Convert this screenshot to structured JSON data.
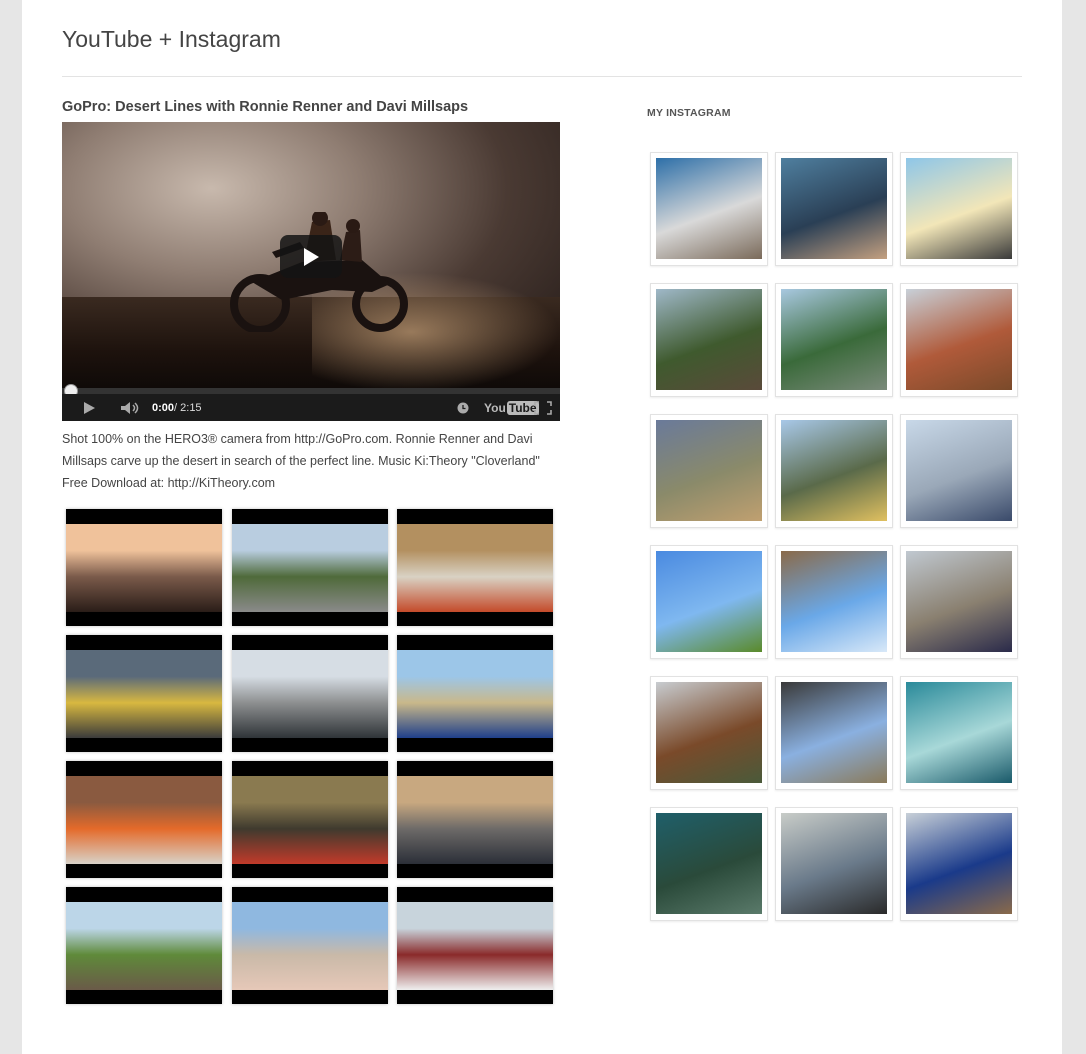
{
  "site": {
    "title": "YouTube + Instagram"
  },
  "post": {
    "title": "GoPro: Desert Lines with Ronnie Renner and Davi Millsaps",
    "description": "Shot 100% on the HERO3® camera from http://GoPro.com. Ronnie Renner and Davi Millsaps carve up the desert in search of the perfect line. Music Ki:Theory \"Cloverland\" Free Download at: http://KiTheory.com"
  },
  "player": {
    "time_current": "0:00",
    "time_total": " / 2:15",
    "progress": 0,
    "logo_you": "You",
    "logo_tube": "Tube",
    "icons": [
      "play-icon",
      "volume-icon",
      "watch-later-icon",
      "youtube-logo-icon",
      "fullscreen-icon"
    ]
  },
  "video_thumbnails": [
    {
      "colors": [
        "#f0c29b",
        "#7a5a4a",
        "#2a1d18"
      ]
    },
    {
      "colors": [
        "#b9cde0",
        "#4f6a3a",
        "#8a8a8a"
      ]
    },
    {
      "colors": [
        "#b39060",
        "#d9d2c4",
        "#c44a2a"
      ]
    },
    {
      "colors": [
        "#5a6a7a",
        "#d8b840",
        "#3b3b3b"
      ]
    },
    {
      "colors": [
        "#d6dde4",
        "#8d8f90",
        "#2f3438"
      ]
    },
    {
      "colors": [
        "#9cc6e8",
        "#c9b88a",
        "#1f3f8a"
      ]
    },
    {
      "colors": [
        "#8a5a40",
        "#e46a2a",
        "#d8d2c8"
      ]
    },
    {
      "colors": [
        "#8a7a50",
        "#3f3a2e",
        "#c23a2a"
      ]
    },
    {
      "colors": [
        "#c8a880",
        "#6d6a68",
        "#2b2f38"
      ]
    },
    {
      "colors": [
        "#bcd6e8",
        "#5f8a3a",
        "#6a5a48"
      ]
    },
    {
      "colors": [
        "#8fb8e0",
        "#c9b9a8",
        "#e6c8b8"
      ]
    },
    {
      "colors": [
        "#c8d4dc",
        "#8a2a2a",
        "#efefef"
      ]
    }
  ],
  "sidebar": {
    "title": "MY INSTAGRAM"
  },
  "instagram_photos": [
    {
      "colors": [
        "#2d6fa8",
        "#d9d9d9",
        "#7a6a5a"
      ]
    },
    {
      "colors": [
        "#4f7f9f",
        "#2a3f55",
        "#c4a080"
      ]
    },
    {
      "colors": [
        "#8ec6e8",
        "#f2e6b8",
        "#3a3a3a"
      ]
    },
    {
      "colors": [
        "#9fb8c8",
        "#3f5a2e",
        "#5a4a3a"
      ]
    },
    {
      "colors": [
        "#a8c8e0",
        "#3a6a3a",
        "#7a8a7a"
      ]
    },
    {
      "colors": [
        "#c8d0d8",
        "#b05a3a",
        "#7a4a2a"
      ]
    },
    {
      "colors": [
        "#6a7a9a",
        "#8a8a6a",
        "#c0a070"
      ]
    },
    {
      "colors": [
        "#a8c8e8",
        "#5a6a4a",
        "#e0c060"
      ]
    },
    {
      "colors": [
        "#c8d8e8",
        "#9aa8b8",
        "#3a4a6a"
      ]
    },
    {
      "colors": [
        "#4a8ae0",
        "#7fb8f0",
        "#5a8a2a"
      ]
    },
    {
      "colors": [
        "#8a6a4a",
        "#6aa8e8",
        "#d8e8f8"
      ]
    },
    {
      "colors": [
        "#c0c8d0",
        "#8a8070",
        "#2a2a4a"
      ]
    },
    {
      "colors": [
        "#c8ccd0",
        "#7a4a2a",
        "#4a5a3a"
      ]
    },
    {
      "colors": [
        "#3a3a3a",
        "#8ab0e0",
        "#8a7a5a"
      ]
    },
    {
      "colors": [
        "#2a8a9a",
        "#a8d8d8",
        "#1a5a6a"
      ]
    },
    {
      "colors": [
        "#1f5f6a",
        "#2a4a3a",
        "#5a7a6a"
      ]
    },
    {
      "colors": [
        "#c8ccc8",
        "#6a7a8a",
        "#2a2a2a"
      ]
    },
    {
      "colors": [
        "#c8d0d8",
        "#1a3a8a",
        "#8a6a4a"
      ]
    }
  ]
}
